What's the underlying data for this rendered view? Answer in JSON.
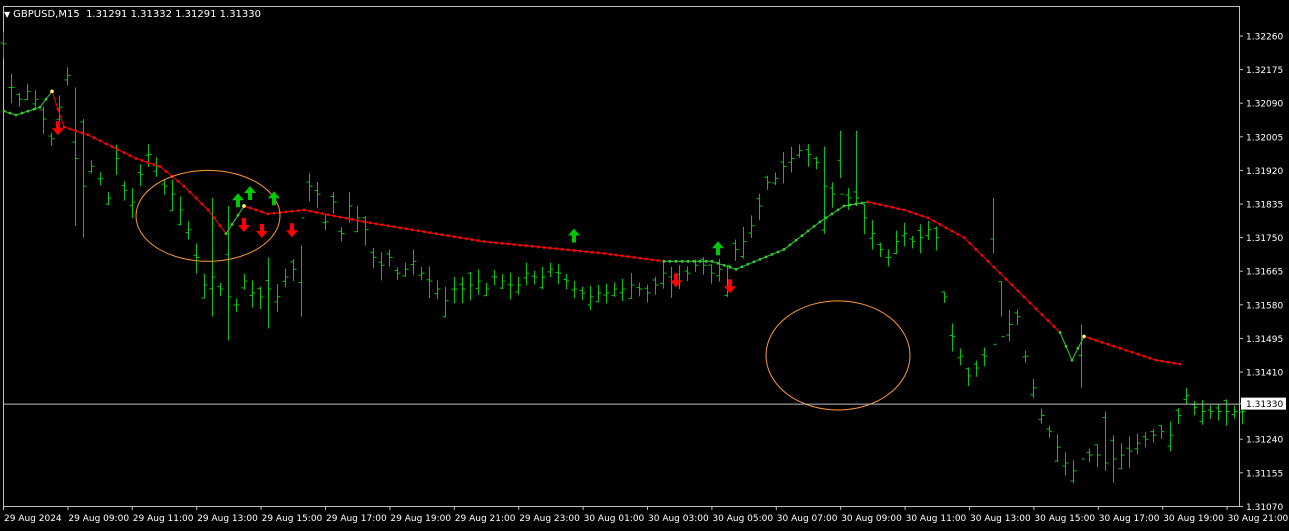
{
  "header": {
    "symbol": "GBPUSD,M15",
    "ohlc": "1.31291 1.31332 1.31291 1.31330",
    "menu_icon": "triangle-down-icon"
  },
  "colors": {
    "background": "#000000",
    "frame": "#c0c0c0",
    "axis_text": "#ffffff",
    "bars": "#00c800",
    "ma_down": "#ff0000",
    "ma_up": "#32cd32",
    "ma_point": "#ffff60",
    "arrow_buy": "#00c800",
    "arrow_sell": "#ff0000",
    "circle": "#ff9933",
    "price_line": "#c0c0c0"
  },
  "chart_data": {
    "type": "ohlc",
    "symbol": "GBPUSD",
    "timeframe": "M15",
    "current_price": "1.31330",
    "y_ticks": [
      "1.32260",
      "1.32175",
      "1.32090",
      "1.32005",
      "1.31920",
      "1.31835",
      "1.31750",
      "1.31665",
      "1.31580",
      "1.31495",
      "1.31410",
      "1.31330",
      "1.31240",
      "1.31155",
      "1.31070"
    ],
    "ylim": [
      1.3104,
      1.3232
    ],
    "x_ticks": [
      "29 Aug 2024",
      "29 Aug 09:00",
      "29 Aug 11:00",
      "29 Aug 13:00",
      "29 Aug 15:00",
      "29 Aug 17:00",
      "29 Aug 19:00",
      "29 Aug 21:00",
      "29 Aug 23:00",
      "30 Aug 01:00",
      "30 Aug 03:00",
      "30 Aug 05:00",
      "30 Aug 07:00",
      "30 Aug 09:00",
      "30 Aug 11:00",
      "30 Aug 13:00",
      "30 Aug 15:00",
      "30 Aug 17:00",
      "30 Aug 19:00",
      "30 Aug 21:00"
    ],
    "bars_per_tick": 8,
    "bar_count": 155,
    "ma_anchors": [
      [
        0,
        1.3207
      ],
      [
        2,
        1.3206
      ],
      [
        4,
        1.3207
      ],
      [
        6,
        1.3208
      ],
      [
        8,
        1.3212
      ],
      [
        10,
        1.3203
      ],
      [
        14,
        1.3201
      ],
      [
        18,
        1.3198
      ],
      [
        22,
        1.3195
      ],
      [
        26,
        1.3193
      ],
      [
        30,
        1.3188
      ],
      [
        34,
        1.3182
      ],
      [
        37,
        1.3176
      ],
      [
        40,
        1.3183
      ],
      [
        44,
        1.3181
      ],
      [
        50,
        1.3182
      ],
      [
        60,
        1.3179
      ],
      [
        80,
        1.3174
      ],
      [
        100,
        1.3171
      ],
      [
        110,
        1.3169
      ],
      [
        118,
        1.3169
      ],
      [
        122,
        1.3167
      ],
      [
        130,
        1.3172
      ],
      [
        136,
        1.3179
      ],
      [
        140,
        1.3183
      ],
      [
        144,
        1.3184
      ],
      [
        150,
        1.3182
      ],
      [
        154,
        1.318
      ],
      [
        160,
        1.3175
      ],
      [
        166,
        1.3166
      ],
      [
        172,
        1.3157
      ],
      [
        176,
        1.3151
      ],
      [
        178,
        1.3144
      ],
      [
        180,
        1.315
      ],
      [
        184,
        1.3148
      ],
      [
        192,
        1.3144
      ],
      [
        196,
        1.3143
      ]
    ],
    "ma_segments": [
      {
        "from": 0,
        "to": 8,
        "trend": "up"
      },
      {
        "from": 8,
        "to": 37,
        "trend": "down"
      },
      {
        "from": 37,
        "to": 40,
        "trend": "up"
      },
      {
        "from": 40,
        "to": 110,
        "trend": "down"
      },
      {
        "from": 110,
        "to": 144,
        "trend": "up"
      },
      {
        "from": 144,
        "to": 176,
        "trend": "down"
      },
      {
        "from": 176,
        "to": 180,
        "trend": "up"
      },
      {
        "from": 180,
        "to": 196,
        "trend": "down"
      }
    ],
    "signals": [
      {
        "bar": 9,
        "type": "sell"
      },
      {
        "bar": 39,
        "type": "buy"
      },
      {
        "bar": 40,
        "type": "sell"
      },
      {
        "bar": 41,
        "type": "buy"
      },
      {
        "bar": 43,
        "type": "sell"
      },
      {
        "bar": 45,
        "type": "buy"
      },
      {
        "bar": 48,
        "type": "sell"
      },
      {
        "bar": 95,
        "type": "buy"
      },
      {
        "bar": 112,
        "type": "sell"
      },
      {
        "bar": 119,
        "type": "buy"
      },
      {
        "bar": 121,
        "type": "sell"
      }
    ],
    "circles": [
      {
        "center_bar": 34,
        "center_price": 1.31805,
        "radius_bars": 9,
        "radius_price": 0.00115
      },
      {
        "center_bar": 139,
        "center_price": 1.31452,
        "radius_bars": 9,
        "radius_price": 0.00138
      }
    ]
  }
}
